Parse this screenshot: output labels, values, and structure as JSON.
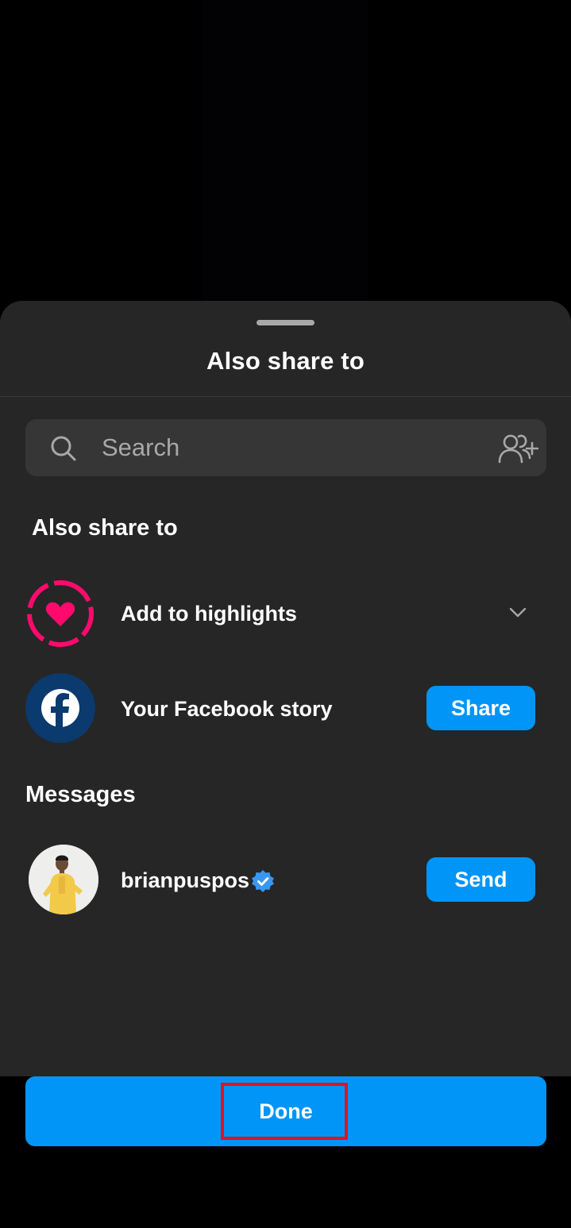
{
  "sheet": {
    "title": "Also share to"
  },
  "search": {
    "placeholder": "Search",
    "search_icon": "search-icon",
    "add_people_icon": "add-people-icon"
  },
  "also_share": {
    "heading": "Also share to",
    "highlights": {
      "label": "Add to highlights",
      "icon": "highlight-heart-icon",
      "expand_icon": "chevron-down-icon"
    },
    "facebook": {
      "label": "Your Facebook story",
      "icon": "facebook-icon",
      "button_label": "Share"
    }
  },
  "messages": {
    "heading": "Messages",
    "contacts": [
      {
        "username": "brianpuspos",
        "verified": true,
        "button_label": "Send"
      }
    ]
  },
  "footer": {
    "done_label": "Done"
  },
  "colors": {
    "sheet_bg": "#262626",
    "accent": "#0095f6",
    "highlight_pink": "#ff0a6c",
    "facebook_blue": "#0a3a6e",
    "annotation_red": "#e8101a"
  }
}
